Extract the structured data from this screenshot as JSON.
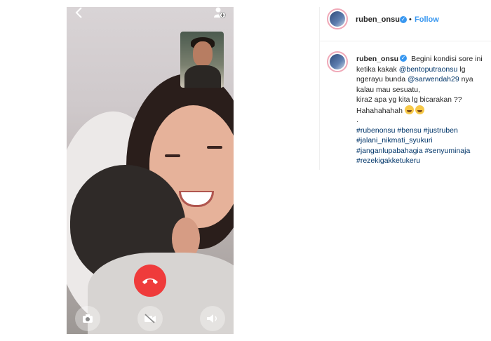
{
  "post": {
    "username": "ruben_onsu",
    "follow_separator": "•",
    "follow_label": "Follow"
  },
  "caption": {
    "username": "ruben_onsu",
    "line1": "Begini kondisi sore ini",
    "line2_pre": "ketika kakak ",
    "line2_mention": "@bentoputraonsu",
    "line2_post": " lg",
    "line3_pre": "ngerayu bunda ",
    "line3_mention": "@sarwendah29",
    "line3_post": " nya",
    "line4": "kalau mau sesuatu,",
    "line5": "kira2 apa yg kita lg bicarakan ??",
    "line6": "Hahahahahah",
    "line7": ".",
    "hashtags_line1_a": "#rubenonsu",
    "hashtags_line1_b": "#bensu",
    "hashtags_line1_c": "#justruben",
    "hashtags_line2": "#jalani_nikmati_syukuri",
    "hashtags_line3_a": "#janganlupabahagia",
    "hashtags_line3_b": "#senyuminaja",
    "hashtags_line4": "#rezekigakketukeru"
  },
  "icons": {
    "back": "chevron-left-icon",
    "add_person": "add-person-icon",
    "end_call": "phone-hangup-icon",
    "camera": "camera-icon",
    "video_off": "video-off-icon",
    "speaker": "speaker-icon",
    "verified": "verified-badge-icon"
  },
  "colors": {
    "end_call": "#ef3b3b",
    "link": "#3897f0",
    "mention": "#003569"
  }
}
